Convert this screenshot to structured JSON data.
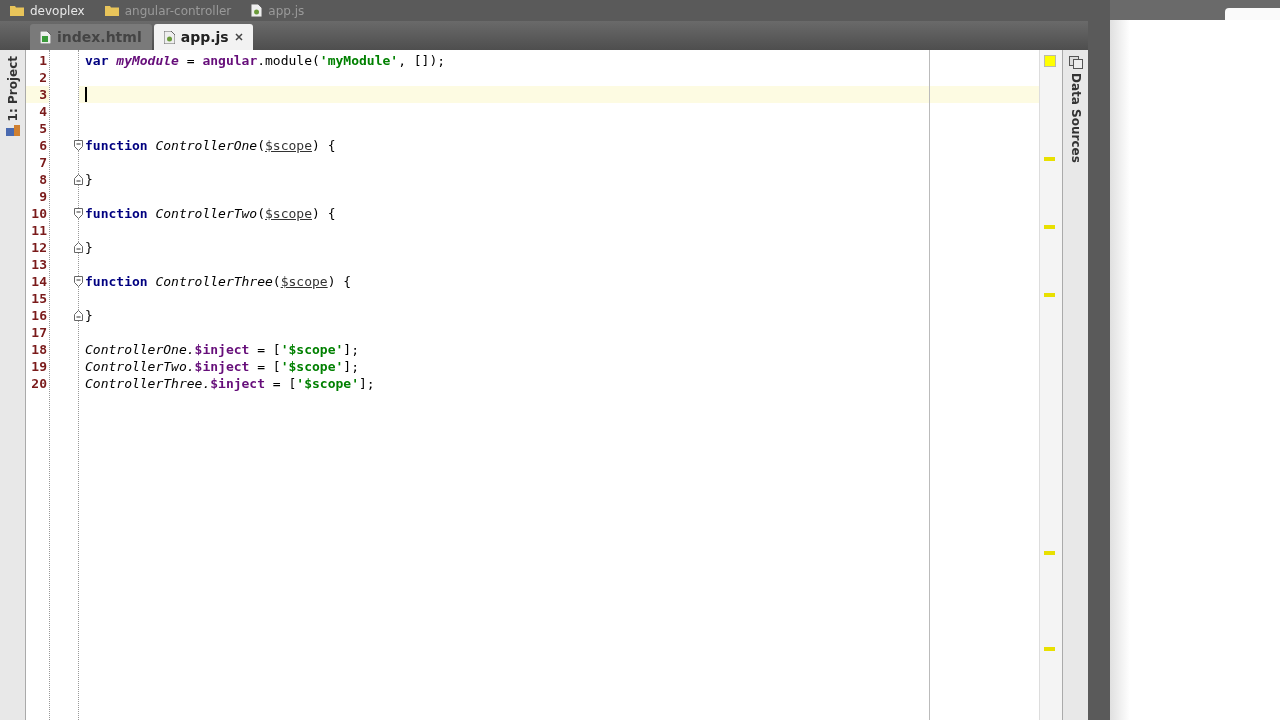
{
  "breadcrumbs": [
    {
      "label": "devoplex",
      "kind": "folder"
    },
    {
      "label": "angular-controller",
      "kind": "folder"
    },
    {
      "label": "app.js",
      "kind": "file"
    }
  ],
  "tabs": [
    {
      "label": "index.html",
      "kind": "html",
      "selected": false
    },
    {
      "label": "app.js",
      "kind": "js",
      "selected": true
    }
  ],
  "left_tool_window": {
    "label": "1: Project"
  },
  "right_tool_window": {
    "label": "Data Sources"
  },
  "editor": {
    "lines": [
      {
        "number": "1",
        "kind": "plain",
        "current": false,
        "tokens": [
          {
            "kind": "keyword",
            "text": "var "
          },
          {
            "kind": "variable",
            "text": "myModule"
          },
          {
            "kind": "plain",
            "text": " = "
          },
          {
            "kind": "global",
            "text": "angular"
          },
          {
            "kind": "plain",
            "text": ".module("
          },
          {
            "kind": "string",
            "text": "'myModule'"
          },
          {
            "kind": "plain",
            "text": ", []);"
          }
        ]
      },
      {
        "number": "2",
        "kind": "plain",
        "current": false
      },
      {
        "number": "3",
        "kind": "plain",
        "current": true
      },
      {
        "number": "4",
        "kind": "plain",
        "current": false
      },
      {
        "number": "5",
        "kind": "plain",
        "current": false
      },
      {
        "number": "6",
        "kind": "fold-start",
        "current": false,
        "tokens": [
          {
            "kind": "keyword",
            "text": "function "
          },
          {
            "kind": "name",
            "text": "ControllerOne"
          },
          {
            "kind": "plain",
            "text": "("
          },
          {
            "kind": "param",
            "text": "$scope"
          },
          {
            "kind": "plain",
            "text": ") {"
          }
        ]
      },
      {
        "number": "7",
        "kind": "plain",
        "current": false
      },
      {
        "number": "8",
        "kind": "fold-end",
        "current": false,
        "tokens": [
          {
            "kind": "plain",
            "text": "}"
          }
        ]
      },
      {
        "number": "9",
        "kind": "plain",
        "current": false
      },
      {
        "number": "10",
        "kind": "fold-start",
        "current": false,
        "tokens": [
          {
            "kind": "keyword",
            "text": "function "
          },
          {
            "kind": "name",
            "text": "ControllerTwo"
          },
          {
            "kind": "plain",
            "text": "("
          },
          {
            "kind": "param",
            "text": "$scope"
          },
          {
            "kind": "plain",
            "text": ") {"
          }
        ]
      },
      {
        "number": "11",
        "kind": "plain",
        "current": false
      },
      {
        "number": "12",
        "kind": "fold-end",
        "current": false,
        "tokens": [
          {
            "kind": "plain",
            "text": "}"
          }
        ]
      },
      {
        "number": "13",
        "kind": "plain",
        "current": false
      },
      {
        "number": "14",
        "kind": "fold-start",
        "current": false,
        "tokens": [
          {
            "kind": "keyword",
            "text": "function "
          },
          {
            "kind": "name",
            "text": "ControllerThree"
          },
          {
            "kind": "plain",
            "text": "("
          },
          {
            "kind": "param",
            "text": "$scope"
          },
          {
            "kind": "plain",
            "text": ") {"
          }
        ]
      },
      {
        "number": "15",
        "kind": "plain",
        "current": false
      },
      {
        "number": "16",
        "kind": "fold-end",
        "current": false,
        "tokens": [
          {
            "kind": "plain",
            "text": "}"
          }
        ]
      },
      {
        "number": "17",
        "kind": "plain",
        "current": false
      },
      {
        "number": "18",
        "kind": "plain",
        "current": false,
        "tokens": [
          {
            "kind": "name",
            "text": "ControllerOne."
          },
          {
            "kind": "global",
            "text": "$inject"
          },
          {
            "kind": "plain",
            "text": " = ["
          },
          {
            "kind": "string",
            "text": "'$scope'"
          },
          {
            "kind": "plain",
            "text": "];"
          }
        ]
      },
      {
        "number": "19",
        "kind": "plain",
        "current": false,
        "tokens": [
          {
            "kind": "name",
            "text": "ControllerTwo."
          },
          {
            "kind": "global",
            "text": "$inject"
          },
          {
            "kind": "plain",
            "text": " = ["
          },
          {
            "kind": "string",
            "text": "'$scope'"
          },
          {
            "kind": "plain",
            "text": "];"
          }
        ]
      },
      {
        "number": "20",
        "kind": "plain",
        "current": false,
        "tokens": [
          {
            "kind": "name",
            "text": "ControllerThree."
          },
          {
            "kind": "global",
            "text": "$inject"
          },
          {
            "kind": "plain",
            "text": " = ["
          },
          {
            "kind": "string",
            "text": "'$scope'"
          },
          {
            "kind": "plain",
            "text": "];"
          }
        ]
      }
    ]
  }
}
